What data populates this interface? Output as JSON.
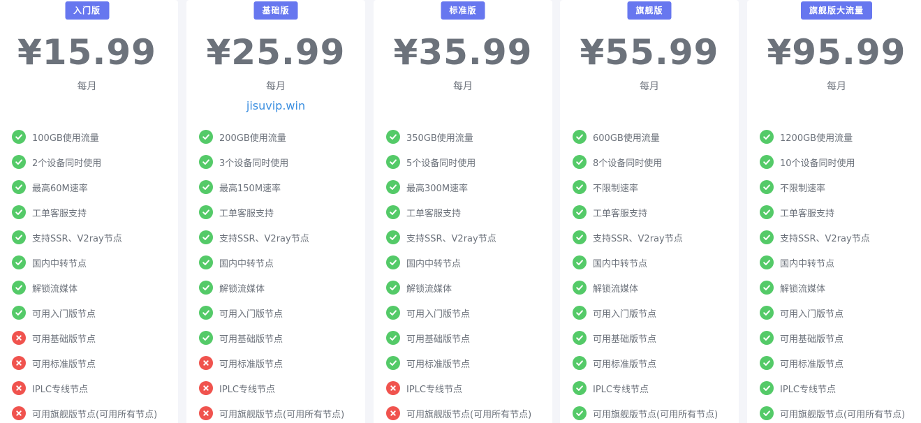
{
  "colors": {
    "badge": "#6777ef",
    "included": "#54ca68",
    "excluded": "#f0534e",
    "text": "#6c727b",
    "link": "#3a8ee0"
  },
  "icons": {
    "included": "check-circle-icon",
    "excluded": "x-circle-icon"
  },
  "plans": [
    {
      "name": "入门版",
      "price": "¥15.99",
      "period": "每月",
      "link": "",
      "features": [
        {
          "text": "100GB使用流量",
          "included": true
        },
        {
          "text": "2个设备同时使用",
          "included": true
        },
        {
          "text": "最高60M速率",
          "included": true
        },
        {
          "text": "工单客服支持",
          "included": true
        },
        {
          "text": "支持SSR、V2ray节点",
          "included": true
        },
        {
          "text": "国内中转节点",
          "included": true
        },
        {
          "text": "解锁流媒体",
          "included": true
        },
        {
          "text": "可用入门版节点",
          "included": true
        },
        {
          "text": "可用基础版节点",
          "included": false
        },
        {
          "text": "可用标准版节点",
          "included": false
        },
        {
          "text": "IPLC专线节点",
          "included": false
        },
        {
          "text": "可用旗舰版节点(可用所有节点)",
          "included": false
        }
      ]
    },
    {
      "name": "基础版",
      "price": "¥25.99",
      "period": "每月",
      "link": "jisuvip.win",
      "features": [
        {
          "text": "200GB使用流量",
          "included": true
        },
        {
          "text": "3个设备同时使用",
          "included": true
        },
        {
          "text": "最高150M速率",
          "included": true
        },
        {
          "text": "工单客服支持",
          "included": true
        },
        {
          "text": "支持SSR、V2ray节点",
          "included": true
        },
        {
          "text": "国内中转节点",
          "included": true
        },
        {
          "text": "解锁流媒体",
          "included": true
        },
        {
          "text": "可用入门版节点",
          "included": true
        },
        {
          "text": "可用基础版节点",
          "included": true
        },
        {
          "text": "可用标准版节点",
          "included": false
        },
        {
          "text": "IPLC专线节点",
          "included": false
        },
        {
          "text": "可用旗舰版节点(可用所有节点)",
          "included": false
        }
      ]
    },
    {
      "name": "标准版",
      "price": "¥35.99",
      "period": "每月",
      "link": "",
      "features": [
        {
          "text": "350GB使用流量",
          "included": true
        },
        {
          "text": "5个设备同时使用",
          "included": true
        },
        {
          "text": "最高300M速率",
          "included": true
        },
        {
          "text": "工单客服支持",
          "included": true
        },
        {
          "text": "支持SSR、V2ray节点",
          "included": true
        },
        {
          "text": "国内中转节点",
          "included": true
        },
        {
          "text": "解锁流媒体",
          "included": true
        },
        {
          "text": "可用入门版节点",
          "included": true
        },
        {
          "text": "可用基础版节点",
          "included": true
        },
        {
          "text": "可用标准版节点",
          "included": true
        },
        {
          "text": "IPLC专线节点",
          "included": false
        },
        {
          "text": "可用旗舰版节点(可用所有节点)",
          "included": false
        }
      ]
    },
    {
      "name": "旗舰版",
      "price": "¥55.99",
      "period": "每月",
      "link": "",
      "features": [
        {
          "text": "600GB使用流量",
          "included": true
        },
        {
          "text": "8个设备同时使用",
          "included": true
        },
        {
          "text": "不限制速率",
          "included": true
        },
        {
          "text": "工单客服支持",
          "included": true
        },
        {
          "text": "支持SSR、V2ray节点",
          "included": true
        },
        {
          "text": "国内中转节点",
          "included": true
        },
        {
          "text": "解锁流媒体",
          "included": true
        },
        {
          "text": "可用入门版节点",
          "included": true
        },
        {
          "text": "可用基础版节点",
          "included": true
        },
        {
          "text": "可用标准版节点",
          "included": true
        },
        {
          "text": "IPLC专线节点",
          "included": true
        },
        {
          "text": "可用旗舰版节点(可用所有节点)",
          "included": true
        }
      ]
    },
    {
      "name": "旗舰版大流量",
      "price": "¥95.99",
      "period": "每月",
      "link": "",
      "features": [
        {
          "text": "1200GB使用流量",
          "included": true
        },
        {
          "text": "10个设备同时使用",
          "included": true
        },
        {
          "text": "不限制速率",
          "included": true
        },
        {
          "text": "工单客服支持",
          "included": true
        },
        {
          "text": "支持SSR、V2ray节点",
          "included": true
        },
        {
          "text": "国内中转节点",
          "included": true
        },
        {
          "text": "解锁流媒体",
          "included": true
        },
        {
          "text": "可用入门版节点",
          "included": true
        },
        {
          "text": "可用基础版节点",
          "included": true
        },
        {
          "text": "可用标准版节点",
          "included": true
        },
        {
          "text": "IPLC专线节点",
          "included": true
        },
        {
          "text": "可用旗舰版节点(可用所有节点)",
          "included": true
        }
      ]
    }
  ]
}
